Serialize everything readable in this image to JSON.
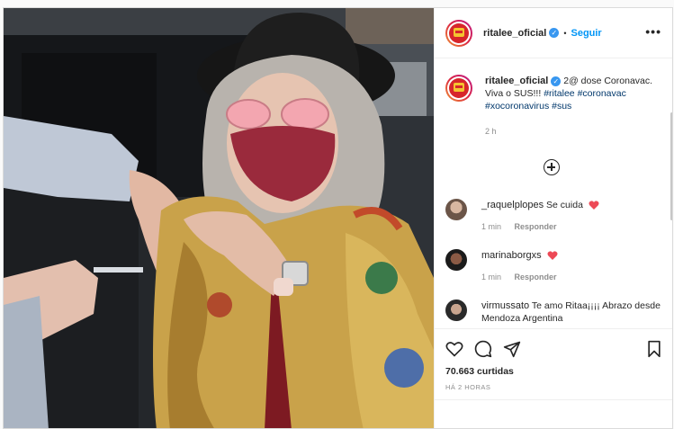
{
  "header": {
    "username": "ritalee_oficial",
    "separator": "•",
    "follow_label": "Seguir",
    "more_label": "•••"
  },
  "caption": {
    "username": "ritalee_oficial",
    "text": "2@ dose Coronavac. Viva o SUS!!!",
    "hashtags": [
      "#ritalee",
      "#coronavac",
      "#xocoronavirus",
      "#sus"
    ],
    "time": "2 h"
  },
  "comments": [
    {
      "username": "_raquelplopes",
      "text": "Se cuida",
      "heart": true,
      "time": "1 min",
      "reply_label": "Responder"
    },
    {
      "username": "marinaborgxs",
      "text": "",
      "heart": true,
      "time": "1 min",
      "reply_label": "Responder"
    },
    {
      "username": "virmussato",
      "text": "Te amo Ritaa¡¡¡¡ Abrazo desde Mendoza Argentina",
      "heart": false
    }
  ],
  "stats": {
    "likes": "70.663 curtidas",
    "posted_ago": "HÁ 2 HORAS"
  },
  "icons": {
    "like": "heart-outline-icon",
    "comment": "comment-icon",
    "share": "paper-plane-icon",
    "save": "bookmark-icon",
    "verified": "verified-badge-icon",
    "load_more": "plus-circle-icon"
  },
  "colors": {
    "follow": "#0095f6",
    "verified": "#3897f0",
    "hashtag": "#00376b",
    "heart": "#ed4956",
    "meta": "#8e8e8e"
  }
}
